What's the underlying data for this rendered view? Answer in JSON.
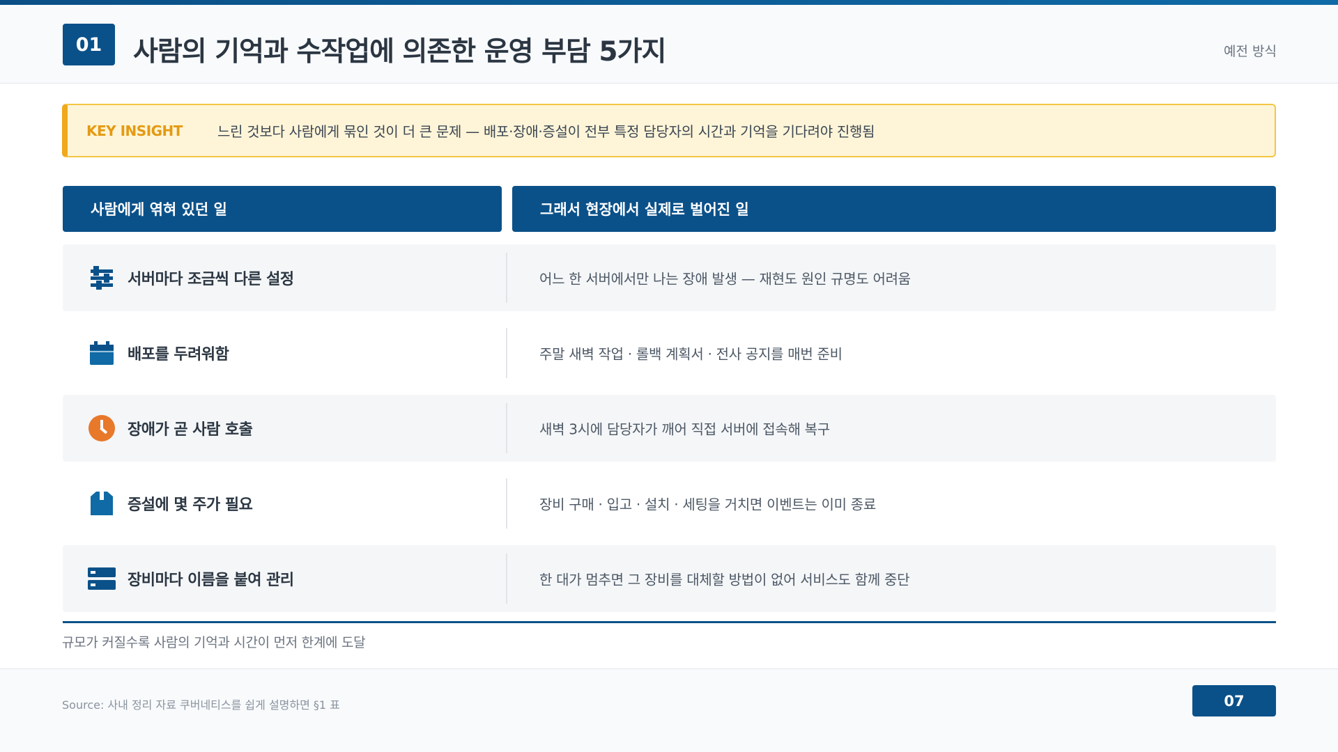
{
  "header": {
    "number": "01",
    "title": "사람의 기억과 수작업에 의존한 운영 부담 5가지",
    "tag": "예전 방식"
  },
  "insight": {
    "label": "KEY INSIGHT",
    "text": "느린 것보다 사람에게 묶인 것이 더 큰 문제 — 배포·장애·증설이 전부 특정 담당자의 시간과 기억을 기다려야 진행됨"
  },
  "columns": {
    "left": "사람에게 엮혀 있던 일",
    "right": "그래서 현장에서 실제로 벌어진 일"
  },
  "rows": [
    {
      "icon": "sliders-icon",
      "label": "서버마다 조금씩 다른 설정",
      "detail": "어느 한 서버에서만 나는 장애 발생 — 재현도 원인 규명도 어려움"
    },
    {
      "icon": "calendar-icon",
      "label": "배포를 두려워함",
      "detail": "주말 새벽 작업 · 롤백 계획서 · 전사 공지를 매번 준비"
    },
    {
      "icon": "clock-icon",
      "label": "장애가 곧 사람 호출",
      "detail": "새벽 3시에 담당자가 깨어 직접 서버에 접속해 복구"
    },
    {
      "icon": "box-icon",
      "label": "증설에 몇 주가 필요",
      "detail": "장비 구매 · 입고 · 설치 · 세팅을 거치면 이벤트는 이미 종료"
    },
    {
      "icon": "server-icon",
      "label": "장비마다 이름을 붙여 관리",
      "detail": "한 대가 멈추면 그 장비를 대체할 방법이 없어 서비스도 함께 중단"
    }
  ],
  "summary": "규모가 커질수록 사람의 기억과 시간이 먼저 한계에 도달",
  "footer": {
    "source": "Source: 사내 정리 자료 쿠버네티스를 쉽게 설명하면 §1 표",
    "page": "07"
  },
  "colors": {
    "primary": "#0b5189",
    "accent": "#f0a81c",
    "clock": "#e8782a"
  }
}
